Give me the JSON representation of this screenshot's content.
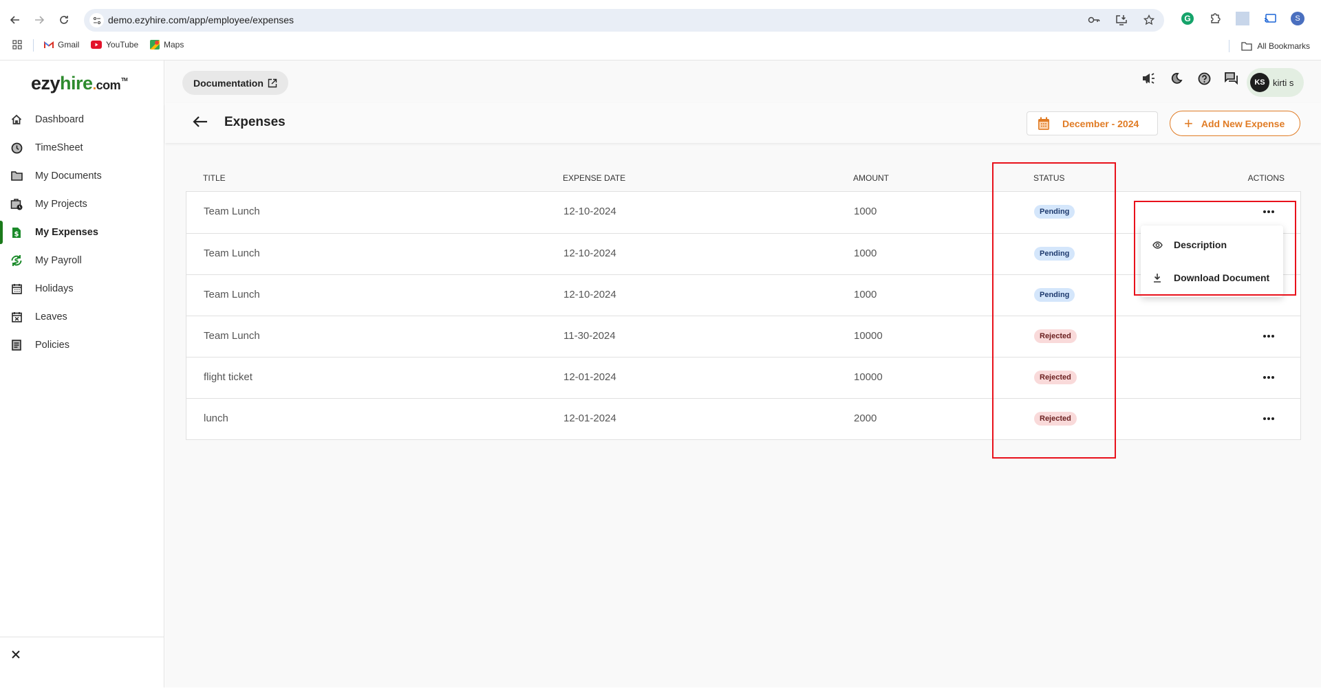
{
  "browser": {
    "url": "demo.ezyhire.com/app/employee/expenses",
    "bookmarks": [
      {
        "label": "Gmail",
        "icon": "gmail-icon"
      },
      {
        "label": "YouTube",
        "icon": "youtube-icon"
      },
      {
        "label": "Maps",
        "icon": "maps-icon"
      }
    ],
    "all_bookmarks_label": "All Bookmarks",
    "profile_initial": "S",
    "extension_initial": "G"
  },
  "sidebar": {
    "logo": {
      "part1": "ezy",
      "part2": "hire",
      "dot": ".",
      "part3": "com",
      "tm": "TM"
    },
    "active_color": "#1b7a1b",
    "items": [
      {
        "label": "Dashboard",
        "icon": "home-icon",
        "active": false
      },
      {
        "label": "TimeSheet",
        "icon": "clock-icon",
        "active": false
      },
      {
        "label": "My Documents",
        "icon": "folder-icon",
        "active": false
      },
      {
        "label": "My Projects",
        "icon": "briefcase-clock-icon",
        "active": false
      },
      {
        "label": "My Expenses",
        "icon": "dollar-file-icon",
        "active": true
      },
      {
        "label": "My Payroll",
        "icon": "payroll-cycle-icon",
        "active": false
      },
      {
        "label": "Holidays",
        "icon": "calendar-icon",
        "active": false
      },
      {
        "label": "Leaves",
        "icon": "calendar-x-icon",
        "active": false
      },
      {
        "label": "Policies",
        "icon": "document-list-icon",
        "active": false
      }
    ]
  },
  "topbar": {
    "documentation_label": "Documentation",
    "user": {
      "initials": "KS",
      "name": "kirti s"
    }
  },
  "page": {
    "title": "Expenses",
    "date_filter": "December - 2024",
    "add_button": "Add New Expense",
    "accent_color": "#e07b24"
  },
  "table": {
    "columns": [
      "TITLE",
      "EXPENSE DATE",
      "AMOUNT",
      "STATUS",
      "ACTIONS"
    ],
    "rows": [
      {
        "title": "Team Lunch",
        "date": "12-10-2024",
        "amount": "1000",
        "status": "Pending"
      },
      {
        "title": "Team Lunch",
        "date": "12-10-2024",
        "amount": "1000",
        "status": "Pending"
      },
      {
        "title": "Team Lunch",
        "date": "12-10-2024",
        "amount": "1000",
        "status": "Pending"
      },
      {
        "title": "Team Lunch",
        "date": "11-30-2024",
        "amount": "10000",
        "status": "Rejected"
      },
      {
        "title": "flight ticket",
        "date": "12-01-2024",
        "amount": "10000",
        "status": "Rejected"
      },
      {
        "title": "lunch",
        "date": "12-01-2024",
        "amount": "2000",
        "status": "Rejected"
      }
    ]
  },
  "actions_menu": {
    "items": [
      {
        "label": "Description",
        "icon": "eye-icon"
      },
      {
        "label": "Download Document",
        "icon": "download-icon"
      }
    ]
  }
}
